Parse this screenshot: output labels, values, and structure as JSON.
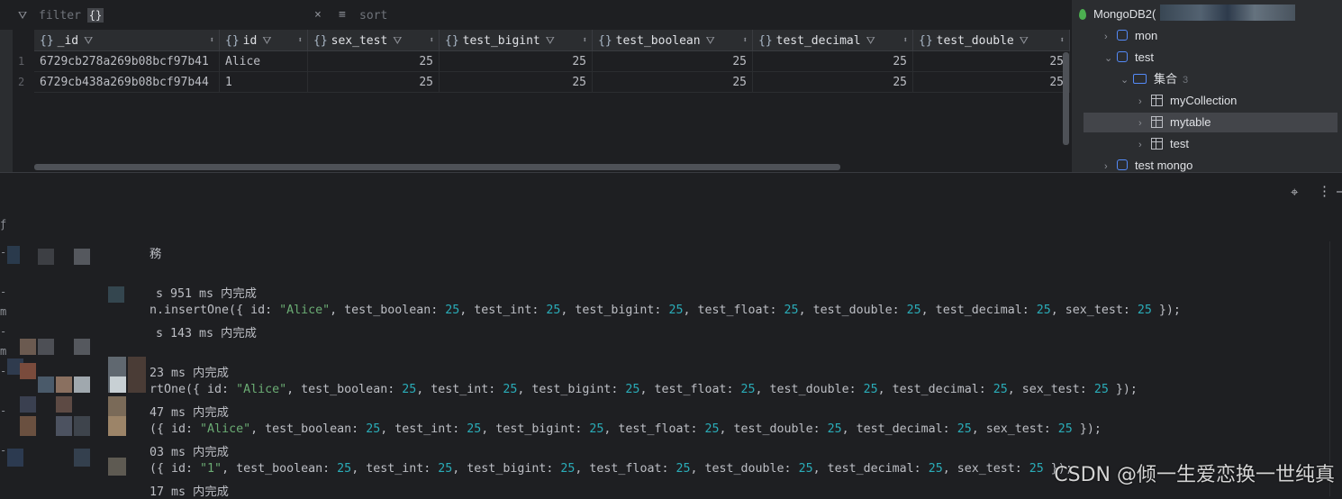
{
  "toolbar": {
    "filter_placeholder": "filter",
    "filter_braces": "{}",
    "clear_glyph": "×",
    "sort_placeholder": "sort"
  },
  "grid": {
    "columns": [
      "_id",
      "id",
      "sex_test",
      "test_bigint",
      "test_boolean",
      "test_decimal",
      "test_double"
    ],
    "rows": [
      {
        "n": "1",
        "cells": [
          "6729cb278a269b08bcf97b41",
          "Alice",
          "25",
          "25",
          "25",
          "25",
          "25"
        ]
      },
      {
        "n": "2",
        "cells": [
          "6729cb438a269b08bcf97b44",
          "1",
          "25",
          "25",
          "25",
          "25",
          "25"
        ]
      }
    ]
  },
  "tree": {
    "root": "MongoDB2(",
    "items": [
      {
        "label": "mon"
      },
      {
        "label": "test"
      },
      {
        "label": "集合",
        "count": "3"
      },
      {
        "label": "myCollection"
      },
      {
        "label": "mytable"
      },
      {
        "label": "test"
      },
      {
        "label": "test mongo"
      }
    ]
  },
  "console": {
    "lines": [
      {
        "gutter": "-",
        "text": "務"
      },
      {
        "gutter": "-",
        "text": "s 951 ms 内完成"
      },
      {
        "gutter": "m",
        "text": "n.insertOne({ id: \"Alice\", test_boolean: 25, test_int: 25, test_bigint: 25, test_float: 25, test_double: 25, test_decimal: 25, sex_test: 25 });"
      },
      {
        "gutter": "-",
        "text": "s 143 ms 内完成"
      },
      {
        "gutter": "m",
        "text": ""
      },
      {
        "gutter": "-",
        "text": "23 ms 内完成"
      },
      {
        "gutter": "",
        "text": "rtOne({ id: \"Alice\", test_boolean: 25, test_int: 25, test_bigint: 25, test_float: 25, test_double: 25, test_decimal: 25, sex_test: 25 });"
      },
      {
        "gutter": "-",
        "text": "47 ms 内完成"
      },
      {
        "gutter": "",
        "text": "({ id: \"Alice\", test_boolean: 25, test_int: 25, test_bigint: 25, test_float: 25, test_double: 25, test_decimal: 25, sex_test: 25 });"
      },
      {
        "gutter": "-",
        "text": "03 ms 内完成"
      },
      {
        "gutter": "",
        "text": "({ id: \"1\", test_boolean: 25, test_int: 25, test_bigint: 25, test_float: 25, test_double: 25, test_decimal: 25, sex_test: 25 });"
      },
      {
        "gutter": "",
        "text": "17 ms 内完成"
      }
    ]
  },
  "watermark": "CSDN @倾一生爱恋换一世纯真",
  "colors": {
    "bg": "#1e1f22",
    "panel": "#2b2d30",
    "string": "#6aab73",
    "number": "#2aacb8",
    "accent": "#548af7"
  },
  "icons": [
    "filter-icon",
    "sort-icon",
    "clear-icon",
    "crosshair-icon",
    "more-icon",
    "chevron-right-icon",
    "chevron-down-icon",
    "database-icon",
    "folder-icon",
    "table-icon",
    "mongodb-leaf-icon"
  ]
}
